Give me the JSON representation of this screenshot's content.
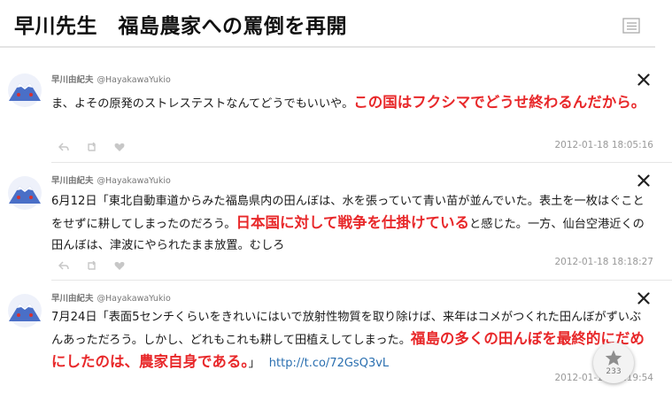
{
  "header": {
    "title": "早川先生　福島農家への罵倒を再開"
  },
  "tweets": [
    {
      "name": "早川由紀夫",
      "handle": "@HayakawaYukio",
      "text_before": "ま、よその原発のストレステストなんてどうでもいいや。",
      "highlight": "この国はフクシマでどうせ終わるんだから。",
      "text_after": "",
      "link": "",
      "timestamp": "2012-01-18 18:05:16"
    },
    {
      "name": "早川由紀夫",
      "handle": "@HayakawaYukio",
      "text_before": "6月12日「東北自動車道からみた福島県内の田んぼは、水を張っていて青い苗が並んでいた。表土を一枚はぐことをせずに耕してしまったのだろう。",
      "highlight": "日本国に対して戦争を仕掛けている",
      "text_after": "と感じた。一方、仙台空港近くの田んぼは、津波にやられたまま放置。むしろ",
      "link": "",
      "timestamp": "2012-01-18 18:18:27"
    },
    {
      "name": "早川由紀夫",
      "handle": "@HayakawaYukio",
      "text_before": "7月24日「表面5センチくらいをきれいにはいで放射性物質を取り除けば、来年はコメがつくれた田んぼがずいぶんあっただろう。しかし、どれもこれも耕して田植えしてしまった。",
      "highlight": "福島の多くの田んぼを最終的にだめにしたのは、農家自身である。",
      "text_after": "」",
      "link": "http://t.co/72GsQ3vL",
      "timestamp": "2012-01-18 18:19:54"
    }
  ],
  "favorite": {
    "count": "233"
  },
  "colors": {
    "highlight": "#e8282a",
    "link": "#2a6fb0"
  }
}
